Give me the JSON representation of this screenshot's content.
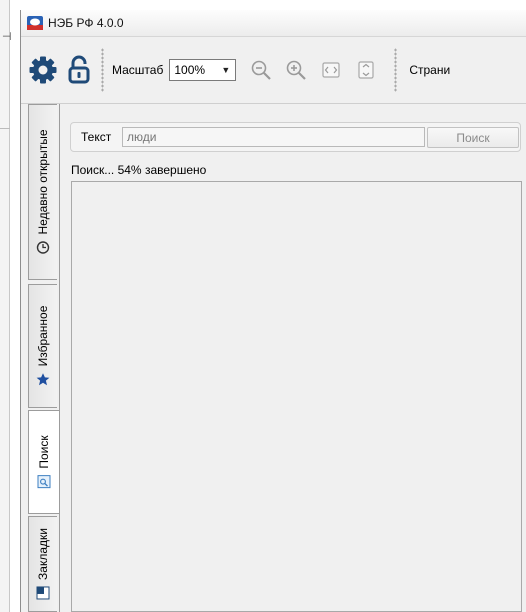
{
  "window": {
    "title": "НЭБ РФ 4.0.0"
  },
  "toolbar": {
    "zoom_label": "Масштаб",
    "zoom_value": "100%",
    "pages_label": "Страни"
  },
  "sidebar": {
    "tabs": [
      {
        "label": "Недавно открытые",
        "icon": "clock-icon",
        "active": false
      },
      {
        "label": "Избранное",
        "icon": "star-icon",
        "active": false
      },
      {
        "label": "Поиск",
        "icon": "search-doc-icon",
        "active": true
      },
      {
        "label": "Закладки",
        "icon": "bookmark-icon",
        "active": false
      }
    ]
  },
  "search": {
    "label": "Текст",
    "placeholder": "люди",
    "button_label": "Поиск",
    "status": "Поиск... 54% завершено"
  },
  "colors": {
    "accent": "#1f4a78",
    "star": "#1f4fa0"
  }
}
